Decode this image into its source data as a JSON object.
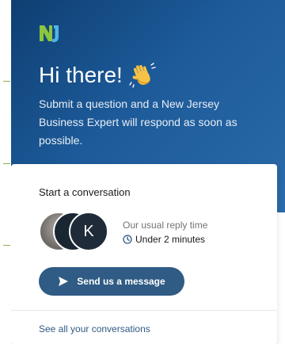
{
  "header": {
    "logo_icon": "nj-logo-icon",
    "greeting": "Hi there!",
    "greeting_icon": "waving-hand-icon",
    "intro": "Submit a question and a New Jersey Business Expert will respond as soon as possible.",
    "background_color": "#1d5a99"
  },
  "card": {
    "title": "Start a conversation",
    "avatars": [
      {
        "kind": "photo"
      },
      {
        "kind": "dark"
      },
      {
        "kind": "initial",
        "initial": "K"
      }
    ],
    "reply_label": "Our usual reply time",
    "reply_time": "Under 2 minutes",
    "reply_icon": "clock-icon",
    "send_button": {
      "label": "Send us a message",
      "icon": "send-icon",
      "color": "#2f5b84"
    },
    "see_all_link": "See all your conversations"
  }
}
